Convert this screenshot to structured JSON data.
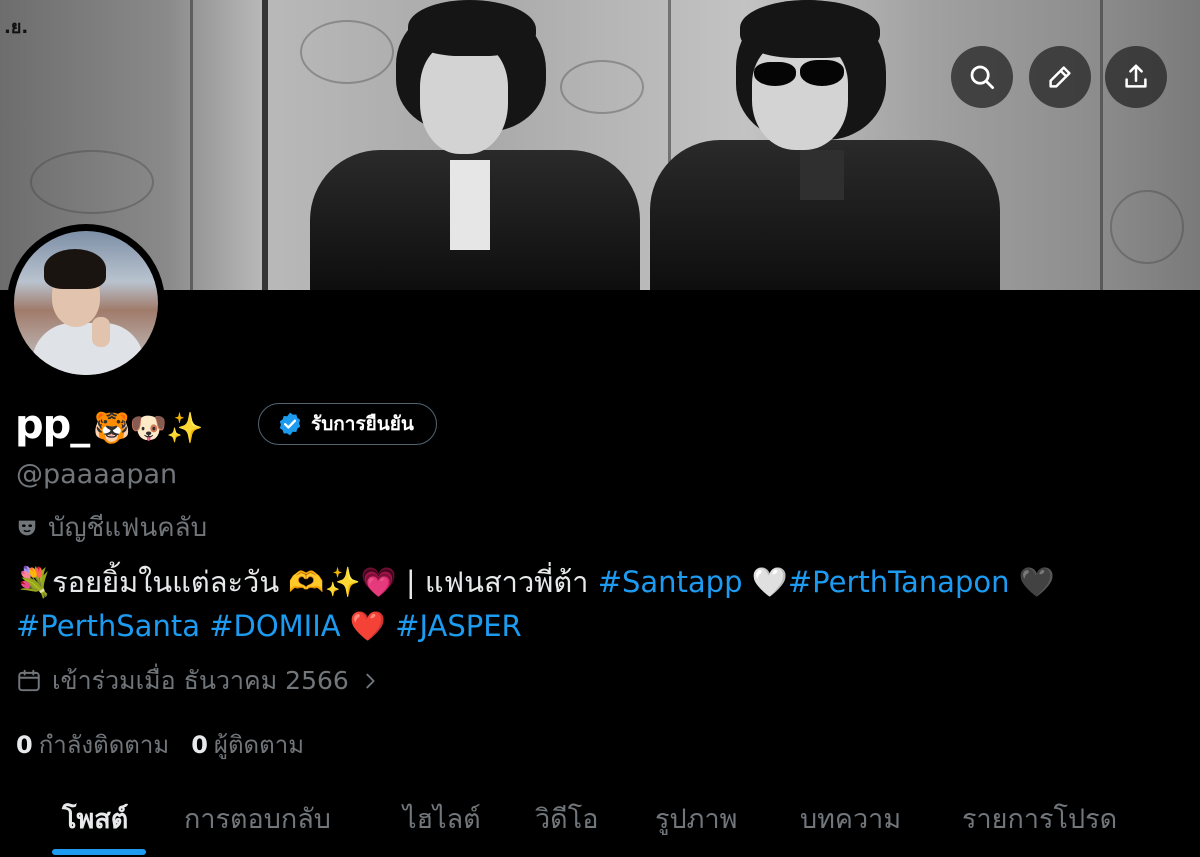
{
  "status_bar": {
    "text": ".ย."
  },
  "banner_buttons": [
    {
      "icon": "search-icon",
      "label": "search"
    },
    {
      "icon": "pencil-icon",
      "label": "edit"
    },
    {
      "icon": "share-icon",
      "label": "share"
    }
  ],
  "profile": {
    "display_name": "pp_",
    "name_emojis": "🐯🐶✨",
    "verify_button_label": "รับการยืนยัน",
    "handle": "@paaaapan",
    "fan_account_label": "บัญชีแฟนคลับ",
    "bio": {
      "text_1": "💐รอยยิ้มในแต่ละวัน 🫶✨💗 | แฟนสาวพี่ต้า ",
      "tag_1": "#Santapp",
      "text_2": " 🤍",
      "tag_2": "#PerthTanapon",
      "text_3": " 🖤",
      "tag_3": "#PerthSanta",
      "text_4": " ",
      "tag_4": "#DOMIIA",
      "text_5": " ❤️ ",
      "tag_5": "#JASPER"
    },
    "joined": "เข้าร่วมเมื่อ ธันวาคม 2566",
    "following_count": "0",
    "following_label": "กำลังติดตาม",
    "followers_count": "0",
    "followers_label": "ผู้ติดตาม"
  },
  "tabs": [
    {
      "label": "โพสต์",
      "active": true
    },
    {
      "label": "การตอบกลับ",
      "active": false
    },
    {
      "label": "ไฮไลต์",
      "active": false
    },
    {
      "label": "วิดีโอ",
      "active": false
    },
    {
      "label": "รูปภาพ",
      "active": false
    },
    {
      "label": "บทความ",
      "active": false
    },
    {
      "label": "รายการโปรด",
      "active": false
    }
  ],
  "colors": {
    "accent": "#1d9bf0",
    "background": "#000000",
    "text_primary": "#e7e9ea",
    "text_secondary": "#71767b"
  }
}
